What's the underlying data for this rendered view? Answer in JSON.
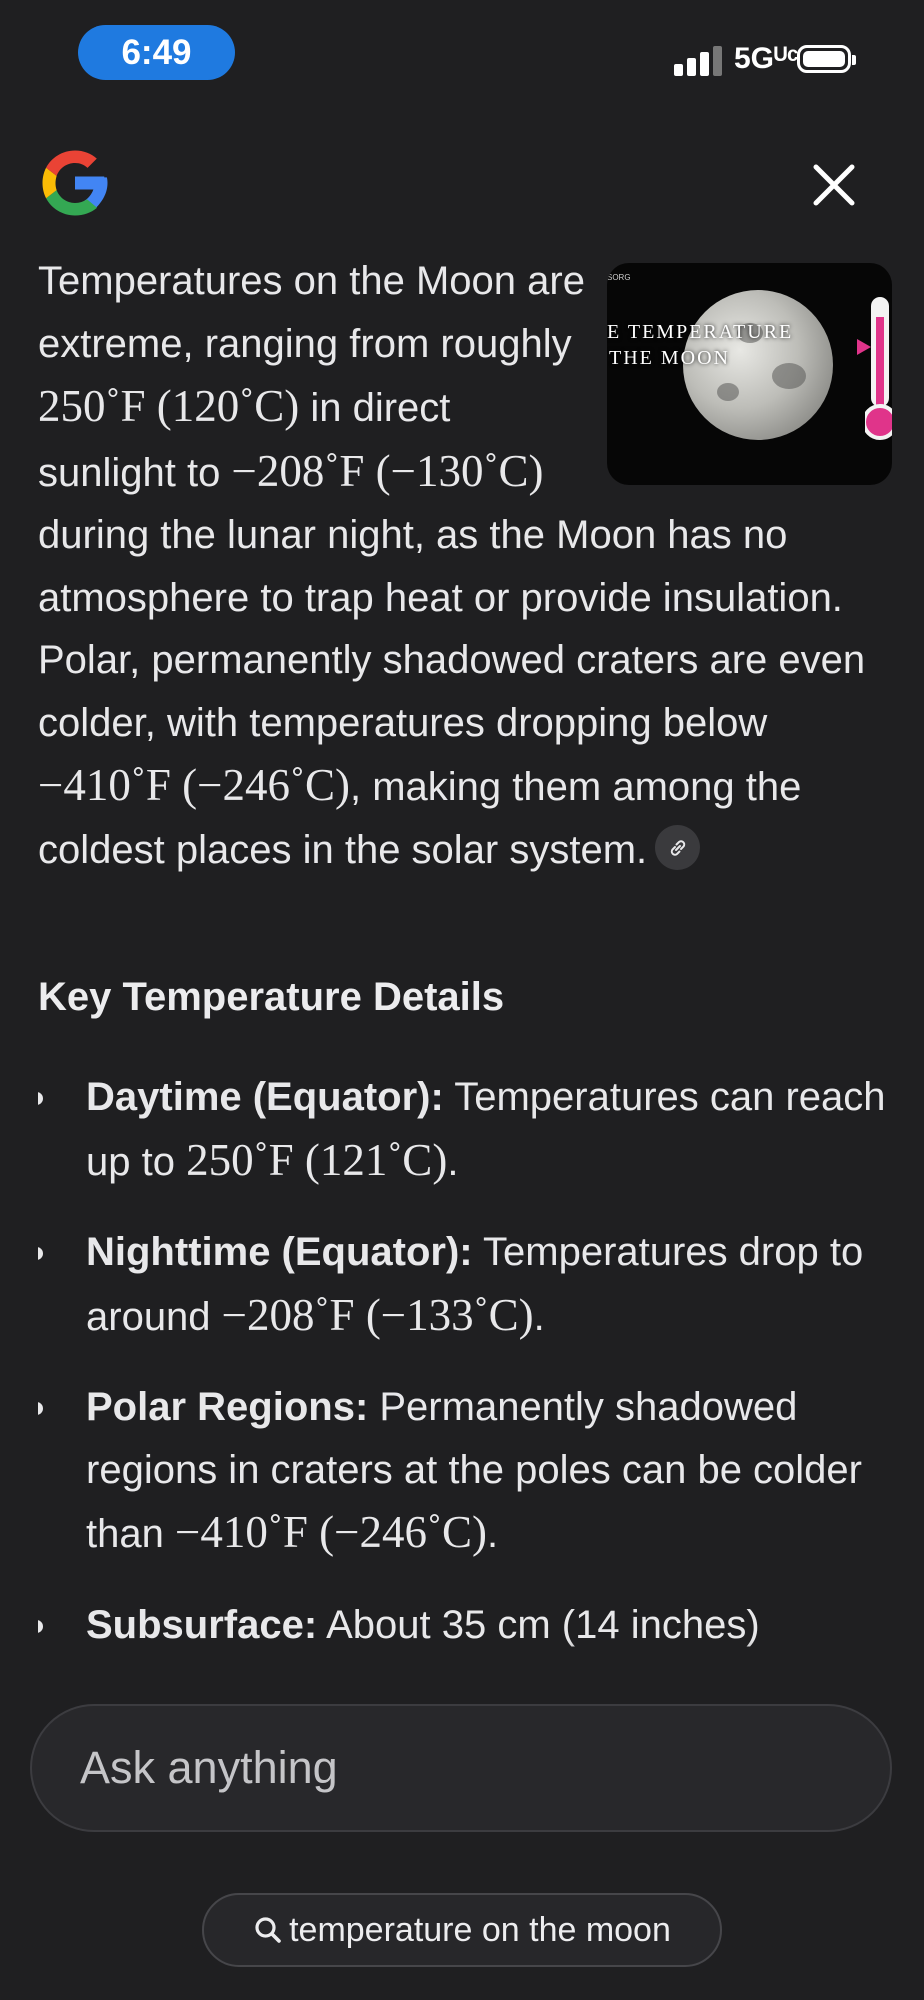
{
  "status_bar": {
    "time": "6:49",
    "network": "5Gᵁᶜ"
  },
  "header": {
    "logo": "google-g-icon",
    "close_icon": "close-icon"
  },
  "answer": {
    "intro_parts": [
      "Temperatures on the Moon are extreme, ranging from roughly ",
      "250˚F (120˚C)",
      " in direct sunlight to ",
      "−208˚F (−130˚C)",
      " during the lunar night, as the Moon has no atmosphere to trap heat or provide insulation. Polar, permanently shadowed craters are even colder, with temperatures dropping below ",
      "−410˚F (−246˚C)",
      ", making them among the coldest places in the solar system."
    ],
    "thumbnail": {
      "caption_line1": "E TEMPERATURE",
      "caption_line2": "THE MOON",
      "tiny_logo": "SORG"
    },
    "section_title": "Key Temperature Details",
    "bullets": [
      {
        "label": "Daytime (Equator):",
        "text": " Temperatures can reach up to ",
        "math": "250˚F (121˚C)",
        "tail": "."
      },
      {
        "label": "Nighttime (Equator):",
        "text": " Temperatures drop to around ",
        "math": "−208˚F (−133˚C)",
        "tail": "."
      },
      {
        "label": "Polar Regions:",
        "text": " Permanently shadowed regions in craters at the poles can be colder than ",
        "math": "−410˚F (−246˚C)",
        "tail": "."
      },
      {
        "label": "Subsurface:",
        "text": " About 35 cm (14 inches)",
        "math": "",
        "tail": ""
      }
    ]
  },
  "ask": {
    "placeholder": "Ask anything"
  },
  "query_chip": {
    "label": "temperature on the moon"
  },
  "colors": {
    "background": "#1f1f21",
    "time_pill": "#1f7ae0",
    "text": "#e8e8ea"
  }
}
